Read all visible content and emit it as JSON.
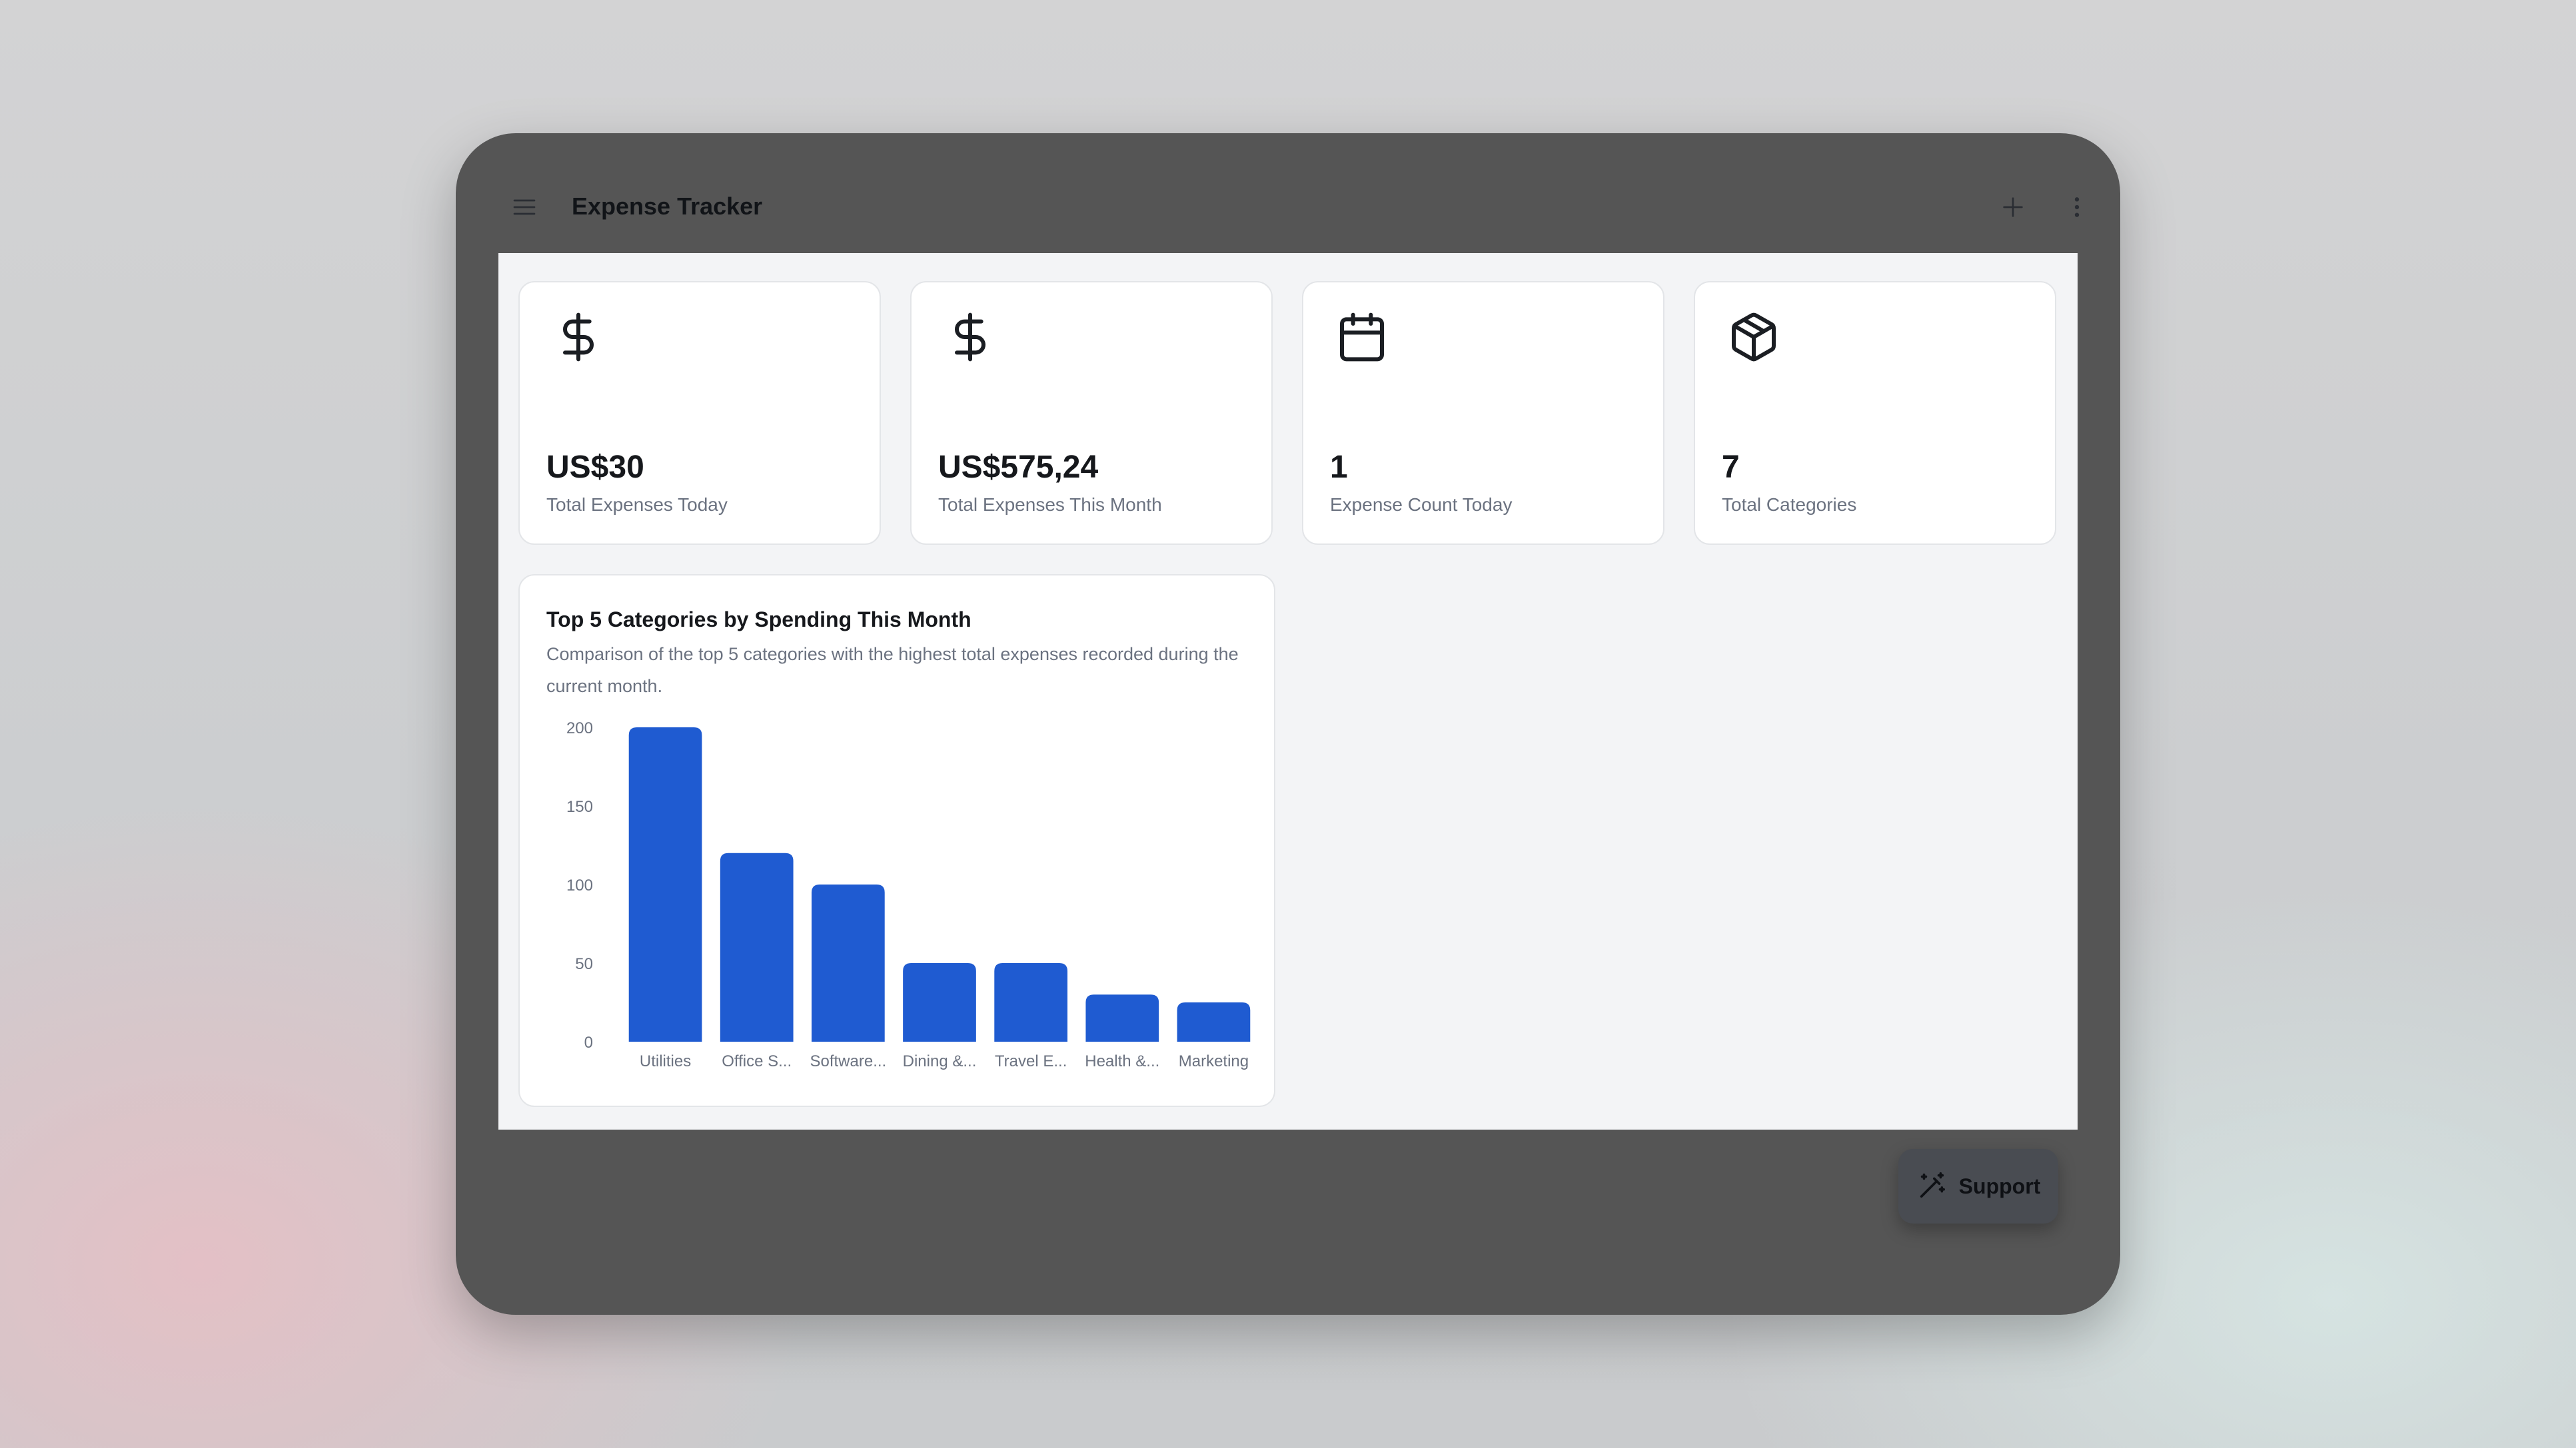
{
  "app": {
    "title": "Expense Tracker"
  },
  "header": {
    "menu_icon": "menu-icon",
    "add_icon": "plus-icon",
    "more_icon": "more-vertical-icon"
  },
  "stats": [
    {
      "icon": "dollar-icon",
      "value": "US$30",
      "label": "Total Expenses Today"
    },
    {
      "icon": "dollar-icon",
      "value": "US$575,24",
      "label": "Total Expenses This Month"
    },
    {
      "icon": "calendar-icon",
      "value": "1",
      "label": "Expense Count Today"
    },
    {
      "icon": "package-icon",
      "value": "7",
      "label": "Total Categories"
    }
  ],
  "chart_card": {
    "title": "Top 5 Categories by Spending This Month",
    "subtitle": "Comparison of the top 5 categories with the highest total expenses recorded during the current month."
  },
  "chart_data": {
    "type": "bar",
    "categories": [
      "Utilities",
      "Office S...",
      "Software...",
      "Dining &...",
      "Travel E...",
      "Health &...",
      "Marketing"
    ],
    "values": [
      200,
      120,
      100,
      50,
      50,
      30,
      25
    ],
    "yticks": [
      0,
      50,
      100,
      150,
      200
    ],
    "ylim": [
      0,
      200
    ],
    "grid": false,
    "bar_color": "#1f5bd1"
  },
  "support": {
    "label": "Support",
    "icon": "magic-wand-icon"
  },
  "colors": {
    "frame": "#555555",
    "content_bg": "#f3f4f6",
    "accent": "#1f5bd1",
    "muted_text": "#6b7280"
  }
}
